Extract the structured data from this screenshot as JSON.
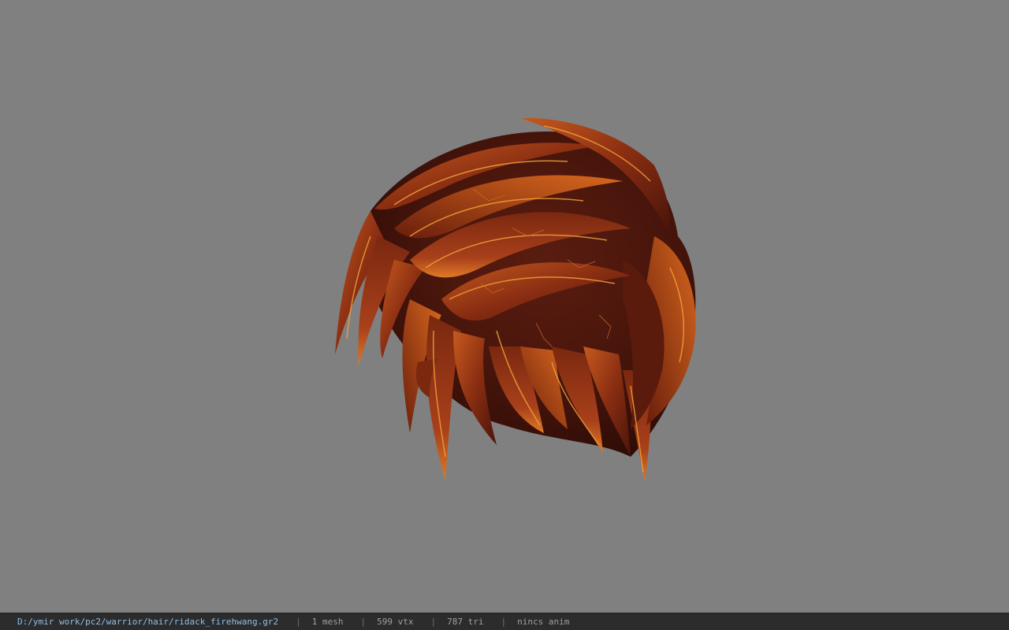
{
  "viewer": {
    "background_color": "#808080",
    "model_icon": "hair-mesh-model"
  },
  "status_bar": {
    "file_path": "D:/ymir work/pc2/warrior/hair/ridack_firehwang.gr2",
    "separator": "|",
    "mesh_count": "1 mesh",
    "vertex_count": "599 vtx",
    "triangle_count": "787 tri",
    "animation": "nincs anim"
  },
  "colors": {
    "hair_dark": "#3a120a",
    "hair_mid": "#7a2a12",
    "hair_light": "#c0501a",
    "hair_highlight": "#e8902a",
    "status_path": "#8fc0e8"
  }
}
